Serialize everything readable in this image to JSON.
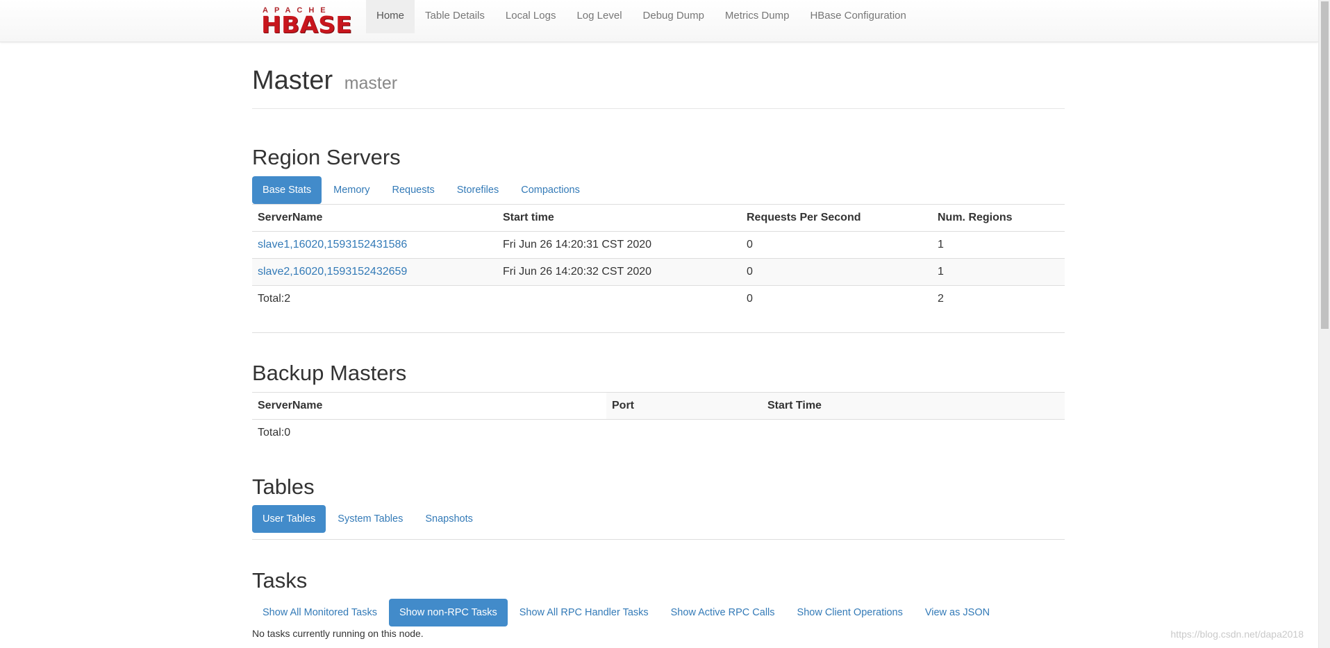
{
  "brand": {
    "apache": "APACHE",
    "hbase": "HBASE"
  },
  "nav": [
    {
      "label": "Home",
      "active": true
    },
    {
      "label": "Table Details"
    },
    {
      "label": "Local Logs"
    },
    {
      "label": "Log Level"
    },
    {
      "label": "Debug Dump"
    },
    {
      "label": "Metrics Dump"
    },
    {
      "label": "HBase Configuration"
    }
  ],
  "header": {
    "title": "Master",
    "subtitle": "master"
  },
  "region_servers": {
    "title": "Region Servers",
    "tabs": [
      "Base Stats",
      "Memory",
      "Requests",
      "Storefiles",
      "Compactions"
    ],
    "columns": [
      "ServerName",
      "Start time",
      "Requests Per Second",
      "Num. Regions"
    ],
    "rows": [
      [
        "slave1,16020,1593152431586",
        "Fri Jun 26 14:20:31 CST 2020",
        "0",
        "1"
      ],
      [
        "slave2,16020,1593152432659",
        "Fri Jun 26 14:20:32 CST 2020",
        "0",
        "1"
      ]
    ],
    "total": {
      "label": "Total:2",
      "requests": "0",
      "regions": "2"
    }
  },
  "backup_masters": {
    "title": "Backup Masters",
    "columns": [
      "ServerName",
      "Port",
      "Start Time"
    ],
    "total": "Total:0"
  },
  "tables": {
    "title": "Tables",
    "tabs": [
      "User Tables",
      "System Tables",
      "Snapshots"
    ]
  },
  "tasks": {
    "title": "Tasks",
    "tabs": [
      "Show All Monitored Tasks",
      "Show non-RPC Tasks",
      "Show All RPC Handler Tasks",
      "Show Active RPC Calls",
      "Show Client Operations",
      "View as JSON"
    ],
    "note": "No tasks currently running on this node."
  },
  "watermark": "https://blog.csdn.net/dapa2018"
}
